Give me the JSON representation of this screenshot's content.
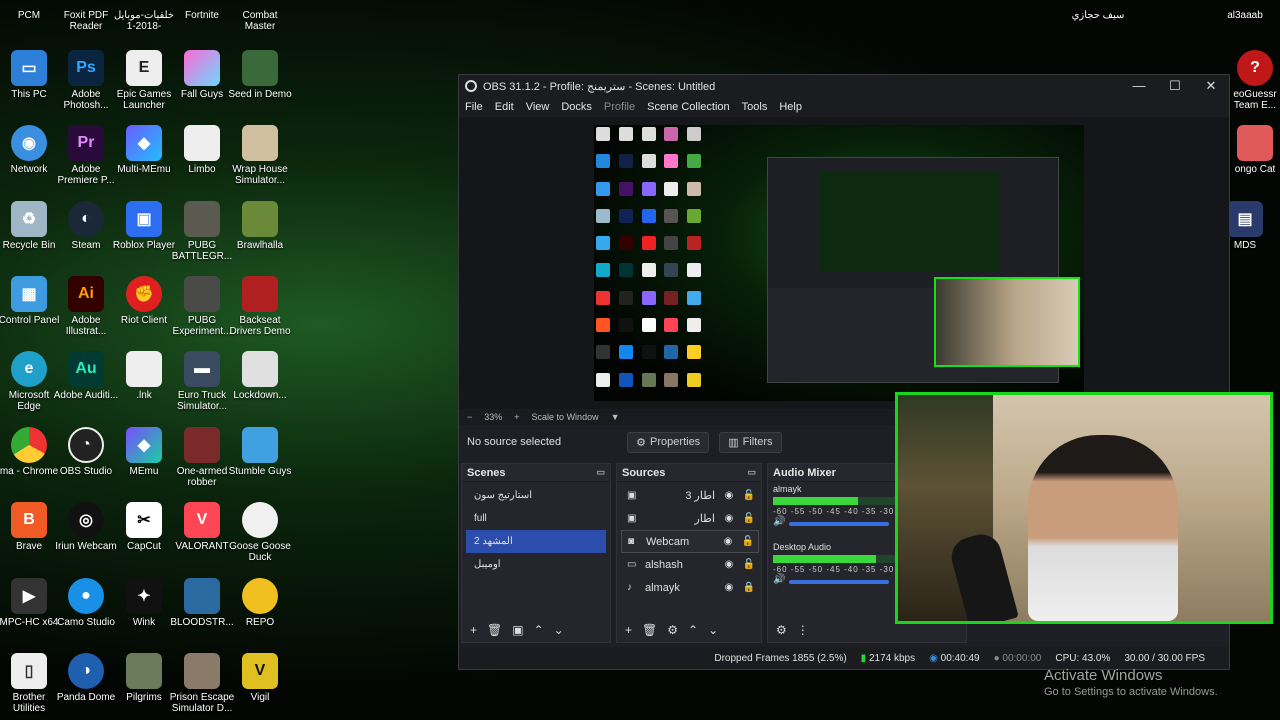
{
  "desktop": {
    "col1": [
      "PCM",
      "This PC",
      "Network",
      "Recycle Bin",
      "Control Panel",
      "Microsoft Edge",
      "ma - Chrome",
      "Brave",
      "MPC-HC x64",
      "Brother Utilities"
    ],
    "col2": [
      "Foxit PDF Reader",
      "Adobe Photosh...",
      "Adobe Premiere P...",
      "Steam",
      "Adobe Illustrat...",
      "Adobe Auditi...",
      "OBS Studio",
      "Iriun Webcam",
      "Camo Studio",
      "Panda Dome"
    ],
    "col3": [
      "خلفيات-موبايل -2018-1",
      "Epic Games Launcher",
      "Multi-MEmu",
      "Roblox Player",
      "Riot Client",
      ".lnk",
      "MEmu",
      "CapCut",
      "Wink",
      "Pilgrims"
    ],
    "col4": [
      "Fortnite",
      "Fall Guys",
      "Limbo",
      "PUBG BATTLEGR...",
      "PUBG Experiment...",
      "Euro Truck Simulator...",
      "One-armed robber",
      "VALORANT",
      "BLOODSTR...",
      "Prison Escape Simulator D..."
    ],
    "col5": [
      "Combat Master",
      "Seed in Demo",
      "Wrap House Simulator...",
      "Brawlhalla",
      "Backseat Drivers Demo",
      "Lockdown...",
      "Stumble Guys",
      "Goose Goose Duck",
      "REPO",
      "Vigil"
    ],
    "right": [
      "سيف حجازي",
      "al3aaab",
      "eoGuessr Team E...",
      "ongo Cat",
      "MDS"
    ]
  },
  "obs": {
    "title": "OBS 31.1.2 - Profile: ستريمنج - Scenes: Untitled",
    "menu": [
      "File",
      "Edit",
      "View",
      "Docks",
      "Profile",
      "Scene Collection",
      "Tools",
      "Help"
    ],
    "zoom": {
      "minus": "−",
      "value": "33%",
      "plus": "+",
      "mode": "Scale to Window",
      "arrow": "▼"
    },
    "no_source": "No source selected",
    "properties": "Properties",
    "filters": "Filters",
    "scenes": {
      "title": "Scenes",
      "items": [
        "استارتيج سون",
        "full",
        "المشهد 2",
        "اوميبل"
      ]
    },
    "sources": {
      "title": "Sources",
      "items": [
        "اطار 3",
        "اطار",
        "Webcam",
        "alshash",
        "almayk"
      ]
    },
    "mixer": {
      "title": "Audio Mixer",
      "channels": [
        {
          "name": "almayk",
          "level": 0.45
        },
        {
          "name": "Desktop Audio",
          "level": 0.55
        }
      ],
      "scale": "-60 -55 -50 -45 -40 -35 -30 -25"
    },
    "status": {
      "dropped": "Dropped Frames 1855 (2.5%)",
      "kbps": "2174 kbps",
      "stream_time": "00:40:49",
      "rec_time": "00:00:00",
      "cpu": "CPU: 43.0%",
      "fps": "30.00 / 30.00 FPS"
    }
  },
  "activation": {
    "title": "Activate Windows",
    "subtitle": "Go to Settings to activate Windows."
  },
  "colors": {
    "accent": "#2b4ead",
    "border_green": "#18d618",
    "meter_green": "#3ad83a"
  }
}
